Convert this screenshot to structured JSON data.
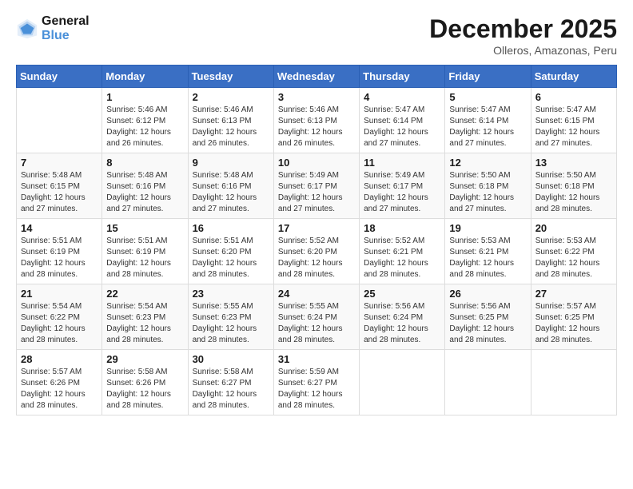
{
  "header": {
    "logo_line1": "General",
    "logo_line2": "Blue",
    "month": "December 2025",
    "location": "Olleros, Amazonas, Peru"
  },
  "days_of_week": [
    "Sunday",
    "Monday",
    "Tuesday",
    "Wednesday",
    "Thursday",
    "Friday",
    "Saturday"
  ],
  "weeks": [
    [
      {
        "day": "",
        "sunrise": "",
        "sunset": "",
        "daylight": ""
      },
      {
        "day": "1",
        "sunrise": "Sunrise: 5:46 AM",
        "sunset": "Sunset: 6:12 PM",
        "daylight": "Daylight: 12 hours and 26 minutes."
      },
      {
        "day": "2",
        "sunrise": "Sunrise: 5:46 AM",
        "sunset": "Sunset: 6:13 PM",
        "daylight": "Daylight: 12 hours and 26 minutes."
      },
      {
        "day": "3",
        "sunrise": "Sunrise: 5:46 AM",
        "sunset": "Sunset: 6:13 PM",
        "daylight": "Daylight: 12 hours and 26 minutes."
      },
      {
        "day": "4",
        "sunrise": "Sunrise: 5:47 AM",
        "sunset": "Sunset: 6:14 PM",
        "daylight": "Daylight: 12 hours and 27 minutes."
      },
      {
        "day": "5",
        "sunrise": "Sunrise: 5:47 AM",
        "sunset": "Sunset: 6:14 PM",
        "daylight": "Daylight: 12 hours and 27 minutes."
      },
      {
        "day": "6",
        "sunrise": "Sunrise: 5:47 AM",
        "sunset": "Sunset: 6:15 PM",
        "daylight": "Daylight: 12 hours and 27 minutes."
      }
    ],
    [
      {
        "day": "7",
        "sunrise": "Sunrise: 5:48 AM",
        "sunset": "Sunset: 6:15 PM",
        "daylight": "Daylight: 12 hours and 27 minutes."
      },
      {
        "day": "8",
        "sunrise": "Sunrise: 5:48 AM",
        "sunset": "Sunset: 6:16 PM",
        "daylight": "Daylight: 12 hours and 27 minutes."
      },
      {
        "day": "9",
        "sunrise": "Sunrise: 5:48 AM",
        "sunset": "Sunset: 6:16 PM",
        "daylight": "Daylight: 12 hours and 27 minutes."
      },
      {
        "day": "10",
        "sunrise": "Sunrise: 5:49 AM",
        "sunset": "Sunset: 6:17 PM",
        "daylight": "Daylight: 12 hours and 27 minutes."
      },
      {
        "day": "11",
        "sunrise": "Sunrise: 5:49 AM",
        "sunset": "Sunset: 6:17 PM",
        "daylight": "Daylight: 12 hours and 27 minutes."
      },
      {
        "day": "12",
        "sunrise": "Sunrise: 5:50 AM",
        "sunset": "Sunset: 6:18 PM",
        "daylight": "Daylight: 12 hours and 27 minutes."
      },
      {
        "day": "13",
        "sunrise": "Sunrise: 5:50 AM",
        "sunset": "Sunset: 6:18 PM",
        "daylight": "Daylight: 12 hours and 28 minutes."
      }
    ],
    [
      {
        "day": "14",
        "sunrise": "Sunrise: 5:51 AM",
        "sunset": "Sunset: 6:19 PM",
        "daylight": "Daylight: 12 hours and 28 minutes."
      },
      {
        "day": "15",
        "sunrise": "Sunrise: 5:51 AM",
        "sunset": "Sunset: 6:19 PM",
        "daylight": "Daylight: 12 hours and 28 minutes."
      },
      {
        "day": "16",
        "sunrise": "Sunrise: 5:51 AM",
        "sunset": "Sunset: 6:20 PM",
        "daylight": "Daylight: 12 hours and 28 minutes."
      },
      {
        "day": "17",
        "sunrise": "Sunrise: 5:52 AM",
        "sunset": "Sunset: 6:20 PM",
        "daylight": "Daylight: 12 hours and 28 minutes."
      },
      {
        "day": "18",
        "sunrise": "Sunrise: 5:52 AM",
        "sunset": "Sunset: 6:21 PM",
        "daylight": "Daylight: 12 hours and 28 minutes."
      },
      {
        "day": "19",
        "sunrise": "Sunrise: 5:53 AM",
        "sunset": "Sunset: 6:21 PM",
        "daylight": "Daylight: 12 hours and 28 minutes."
      },
      {
        "day": "20",
        "sunrise": "Sunrise: 5:53 AM",
        "sunset": "Sunset: 6:22 PM",
        "daylight": "Daylight: 12 hours and 28 minutes."
      }
    ],
    [
      {
        "day": "21",
        "sunrise": "Sunrise: 5:54 AM",
        "sunset": "Sunset: 6:22 PM",
        "daylight": "Daylight: 12 hours and 28 minutes."
      },
      {
        "day": "22",
        "sunrise": "Sunrise: 5:54 AM",
        "sunset": "Sunset: 6:23 PM",
        "daylight": "Daylight: 12 hours and 28 minutes."
      },
      {
        "day": "23",
        "sunrise": "Sunrise: 5:55 AM",
        "sunset": "Sunset: 6:23 PM",
        "daylight": "Daylight: 12 hours and 28 minutes."
      },
      {
        "day": "24",
        "sunrise": "Sunrise: 5:55 AM",
        "sunset": "Sunset: 6:24 PM",
        "daylight": "Daylight: 12 hours and 28 minutes."
      },
      {
        "day": "25",
        "sunrise": "Sunrise: 5:56 AM",
        "sunset": "Sunset: 6:24 PM",
        "daylight": "Daylight: 12 hours and 28 minutes."
      },
      {
        "day": "26",
        "sunrise": "Sunrise: 5:56 AM",
        "sunset": "Sunset: 6:25 PM",
        "daylight": "Daylight: 12 hours and 28 minutes."
      },
      {
        "day": "27",
        "sunrise": "Sunrise: 5:57 AM",
        "sunset": "Sunset: 6:25 PM",
        "daylight": "Daylight: 12 hours and 28 minutes."
      }
    ],
    [
      {
        "day": "28",
        "sunrise": "Sunrise: 5:57 AM",
        "sunset": "Sunset: 6:26 PM",
        "daylight": "Daylight: 12 hours and 28 minutes."
      },
      {
        "day": "29",
        "sunrise": "Sunrise: 5:58 AM",
        "sunset": "Sunset: 6:26 PM",
        "daylight": "Daylight: 12 hours and 28 minutes."
      },
      {
        "day": "30",
        "sunrise": "Sunrise: 5:58 AM",
        "sunset": "Sunset: 6:27 PM",
        "daylight": "Daylight: 12 hours and 28 minutes."
      },
      {
        "day": "31",
        "sunrise": "Sunrise: 5:59 AM",
        "sunset": "Sunset: 6:27 PM",
        "daylight": "Daylight: 12 hours and 28 minutes."
      },
      {
        "day": "",
        "sunrise": "",
        "sunset": "",
        "daylight": ""
      },
      {
        "day": "",
        "sunrise": "",
        "sunset": "",
        "daylight": ""
      },
      {
        "day": "",
        "sunrise": "",
        "sunset": "",
        "daylight": ""
      }
    ]
  ]
}
